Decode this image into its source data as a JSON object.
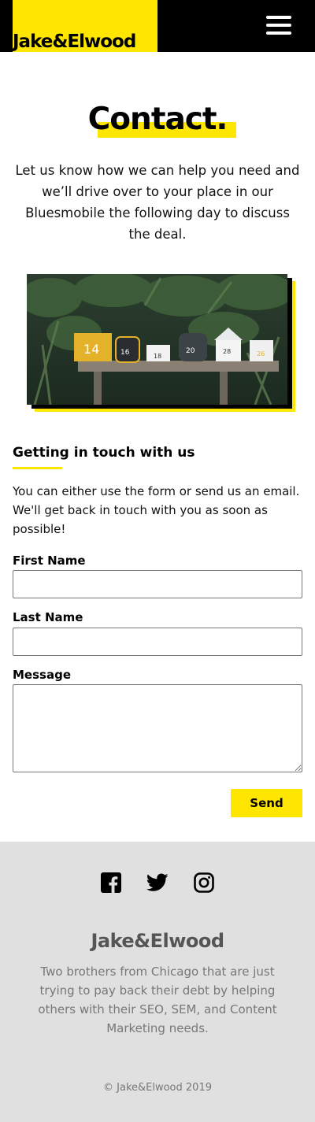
{
  "header": {
    "logo": "Jake&Elwood",
    "menu_icon": "hamburger-menu-icon",
    "colors": {
      "brand_yellow": "#ffe600",
      "bar": "#000000"
    }
  },
  "contact": {
    "title": "Contact.",
    "intro": "Let us know how we can help you need and we’ll drive over to your place in our Bluesmobile the following day to discuss the deal.",
    "photo_numbers": [
      "14",
      "16",
      "18",
      "20",
      "28",
      "26"
    ]
  },
  "getting_in_touch": {
    "title": "Getting in touch with us",
    "text": "You can either use the form or send us an email. We'll get back in touch with you as soon as possible!"
  },
  "form": {
    "first_name_label": "First Name",
    "first_name_value": "",
    "last_name_label": "Last Name",
    "last_name_value": "",
    "message_label": "Message",
    "message_value": "",
    "send_label": "Send"
  },
  "footer": {
    "social_icons": [
      "facebook-icon",
      "twitter-icon",
      "instagram-icon"
    ],
    "logo": "Jake&Elwood",
    "text": "Two brothers from Chicago that are just trying to pay back their debt by helping others with their SEO, SEM, and Content Marketing needs.",
    "copyright": "© Jake&Elwood 2019"
  }
}
